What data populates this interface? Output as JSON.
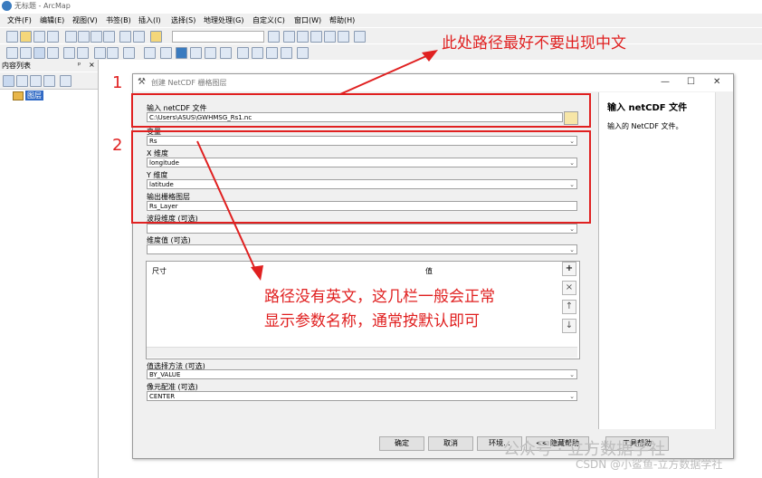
{
  "app": {
    "window_title": "无标题 - ArcMap"
  },
  "menubar": {
    "items": [
      "文件(F)",
      "编辑(E)",
      "视图(V)",
      "书签(B)",
      "插入(I)",
      "选择(S)",
      "地理处理(G)",
      "自定义(C)",
      "窗口(W)",
      "帮助(H)"
    ]
  },
  "toc": {
    "title": "内容列表",
    "pin": "ᵖ",
    "close": "×",
    "layer_label": "图层"
  },
  "dialog": {
    "title": "创建 NetCDF 栅格图层",
    "fields": {
      "input_label": "输入 netCDF 文件",
      "input_value": "C:\\Users\\ASUS\\GWHMSG_Rs1.nc",
      "variable_label": "变量",
      "variable_value": "Rs",
      "x_label": "X 维度",
      "x_value": "longitude",
      "y_label": "Y 维度",
      "y_value": "latitude",
      "out_label": "输出栅格图层",
      "out_value": "Rs_Layer",
      "band_label": "波段维度 (可选)",
      "band_value": "",
      "dimval_label": "维度值 (可选)",
      "dim_col1": "尺寸",
      "dim_col2": "值",
      "method_label": "值选择方法 (可选)",
      "method_value": "BY_VALUE",
      "cell_label": "像元配准 (可选)",
      "cell_value": "CENTER"
    },
    "side_buttons": [
      "+",
      "×",
      "↑",
      "↓"
    ],
    "help": {
      "title": "输入 netCDF 文件",
      "text": "输入的 NetCDF 文件。"
    },
    "buttons": {
      "ok": "确定",
      "cancel": "取消",
      "env": "环境...",
      "hide_help": "<< 隐藏帮助",
      "tool_help": "工具帮助"
    }
  },
  "annotations": {
    "box1_num": "1",
    "box2_num": "2",
    "top_note": "此处路径最好不要出现中文",
    "mid_note_line1": "路径没有英文，这几栏一般会正常",
    "mid_note_line2": "显示参数名称，通常按默认即可"
  },
  "watermark": {
    "line1": "公众号 · 立方数据学社",
    "line2": "CSDN @小鲨鱼-立方数据学社"
  },
  "colors": {
    "annotation": "#e02020",
    "selected_layer": "#316ac5"
  }
}
